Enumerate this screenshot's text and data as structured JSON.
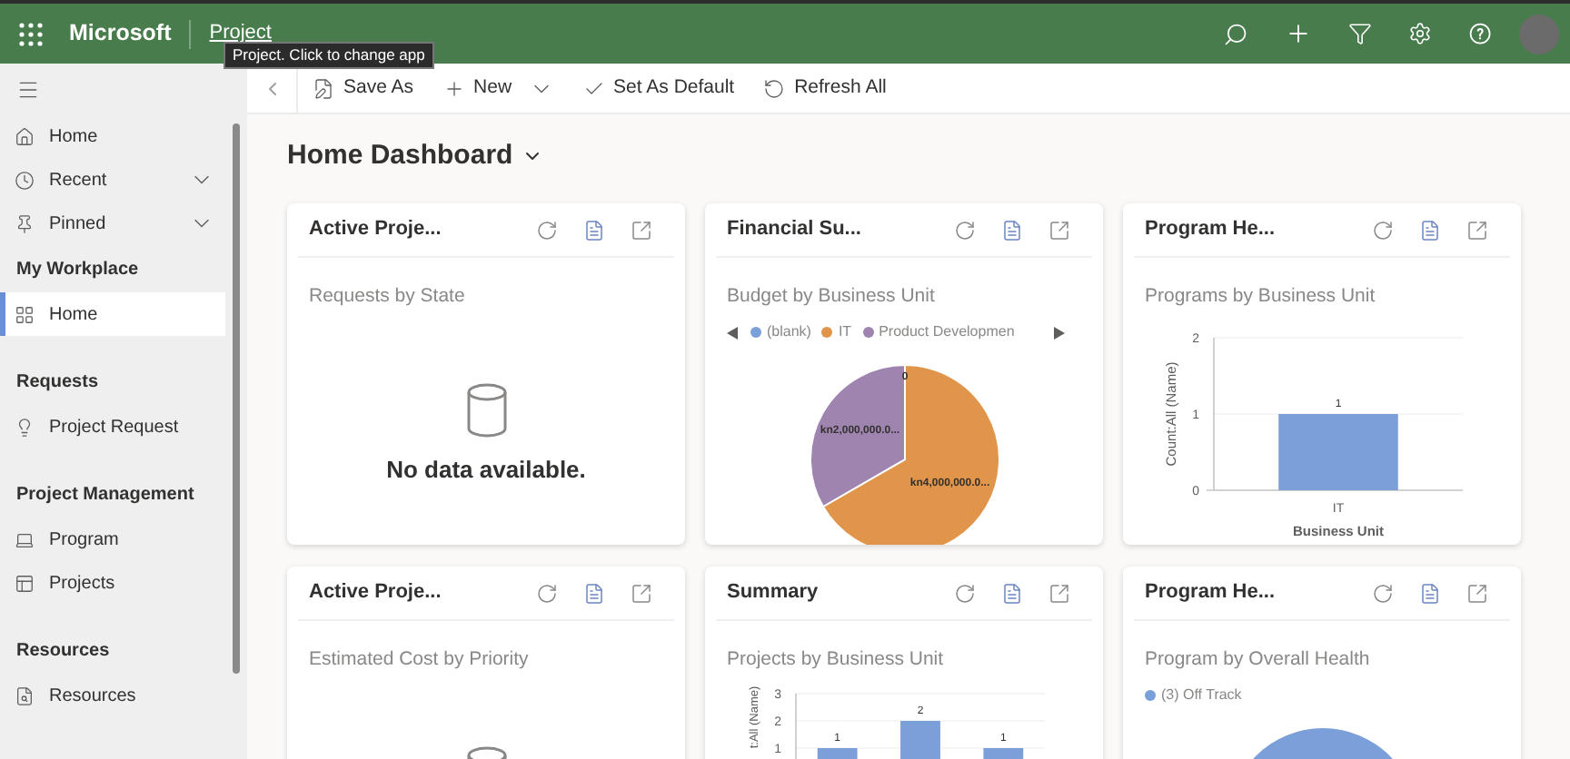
{
  "top_bar": {
    "brand": "Microsoft",
    "app": "Project",
    "tooltip": "Project. Click to change app"
  },
  "command_bar": [
    {
      "label": "Save As",
      "has_menu": false
    },
    {
      "label": "New",
      "has_menu": true
    },
    {
      "label": "Set As Default",
      "has_menu": false
    },
    {
      "label": "Refresh All",
      "has_menu": false
    }
  ],
  "sidebar": {
    "top_items": [
      {
        "label": "Home",
        "expandable": false,
        "selected": false
      },
      {
        "label": "Recent",
        "expandable": true,
        "selected": false
      },
      {
        "label": "Pinned",
        "expandable": true,
        "selected": false
      }
    ],
    "sections": [
      {
        "heading": "My Workplace",
        "items": [
          {
            "label": "Home",
            "selected": true
          }
        ]
      },
      {
        "heading": "Requests",
        "items": [
          {
            "label": "Project Request",
            "selected": false
          }
        ]
      },
      {
        "heading": "Project Management",
        "items": [
          {
            "label": "Program",
            "selected": false
          },
          {
            "label": "Projects",
            "selected": false
          }
        ]
      },
      {
        "heading": "Resources",
        "items": [
          {
            "label": "Resources",
            "selected": false
          }
        ]
      }
    ]
  },
  "dashboard": {
    "title": "Home Dashboard",
    "cards": [
      {
        "title": "Active Proje...",
        "subtitle": "Requests by State",
        "empty_text": "No data available."
      },
      {
        "title": "Financial Su...",
        "subtitle": "Budget by Business Unit",
        "legend": [
          {
            "color": "#7a9fd9"
          },
          {
            "color": "#e0954a"
          },
          {
            "color": "#a084b0"
          }
        ],
        "legend_paged": true,
        "chart_data": {
          "type": "pie",
          "categories": [
            "(blank)",
            "IT",
            "Product Developmen"
          ],
          "values": [
            0,
            4000000,
            2000000
          ],
          "value_labels": [
            "0",
            "kn4,000,000.0...",
            "kn2,000,000.0..."
          ]
        }
      },
      {
        "title": "Program He...",
        "subtitle": "Programs by Business Unit",
        "chart_data": {
          "type": "bar",
          "xlabel": "Business Unit",
          "ylabel": "Count:All (Name)",
          "categories": [
            "IT"
          ],
          "values": [
            1
          ],
          "ylim": [
            0,
            2
          ],
          "yticks": [
            0,
            1,
            2
          ],
          "data_labels": true
        }
      },
      {
        "title": "Active Proje...",
        "subtitle": "Estimated Cost by Priority"
      },
      {
        "title": "Summary",
        "subtitle": "Projects by Business Unit",
        "chart_data": {
          "type": "bar",
          "ylabel": "t:All (Name)",
          "values": [
            1,
            2,
            1
          ],
          "ylim": [
            0,
            3
          ],
          "yticks": [
            1,
            2,
            3
          ],
          "data_labels": true
        }
      },
      {
        "title": "Program He...",
        "subtitle": "Program by Overall Health",
        "legend": [
          {
            "color": "#7a9fd9"
          }
        ],
        "legend_paged": false,
        "chart_data": {
          "type": "pie",
          "categories": [
            "(3) Off Track"
          ],
          "values": [
            3
          ]
        }
      }
    ]
  }
}
